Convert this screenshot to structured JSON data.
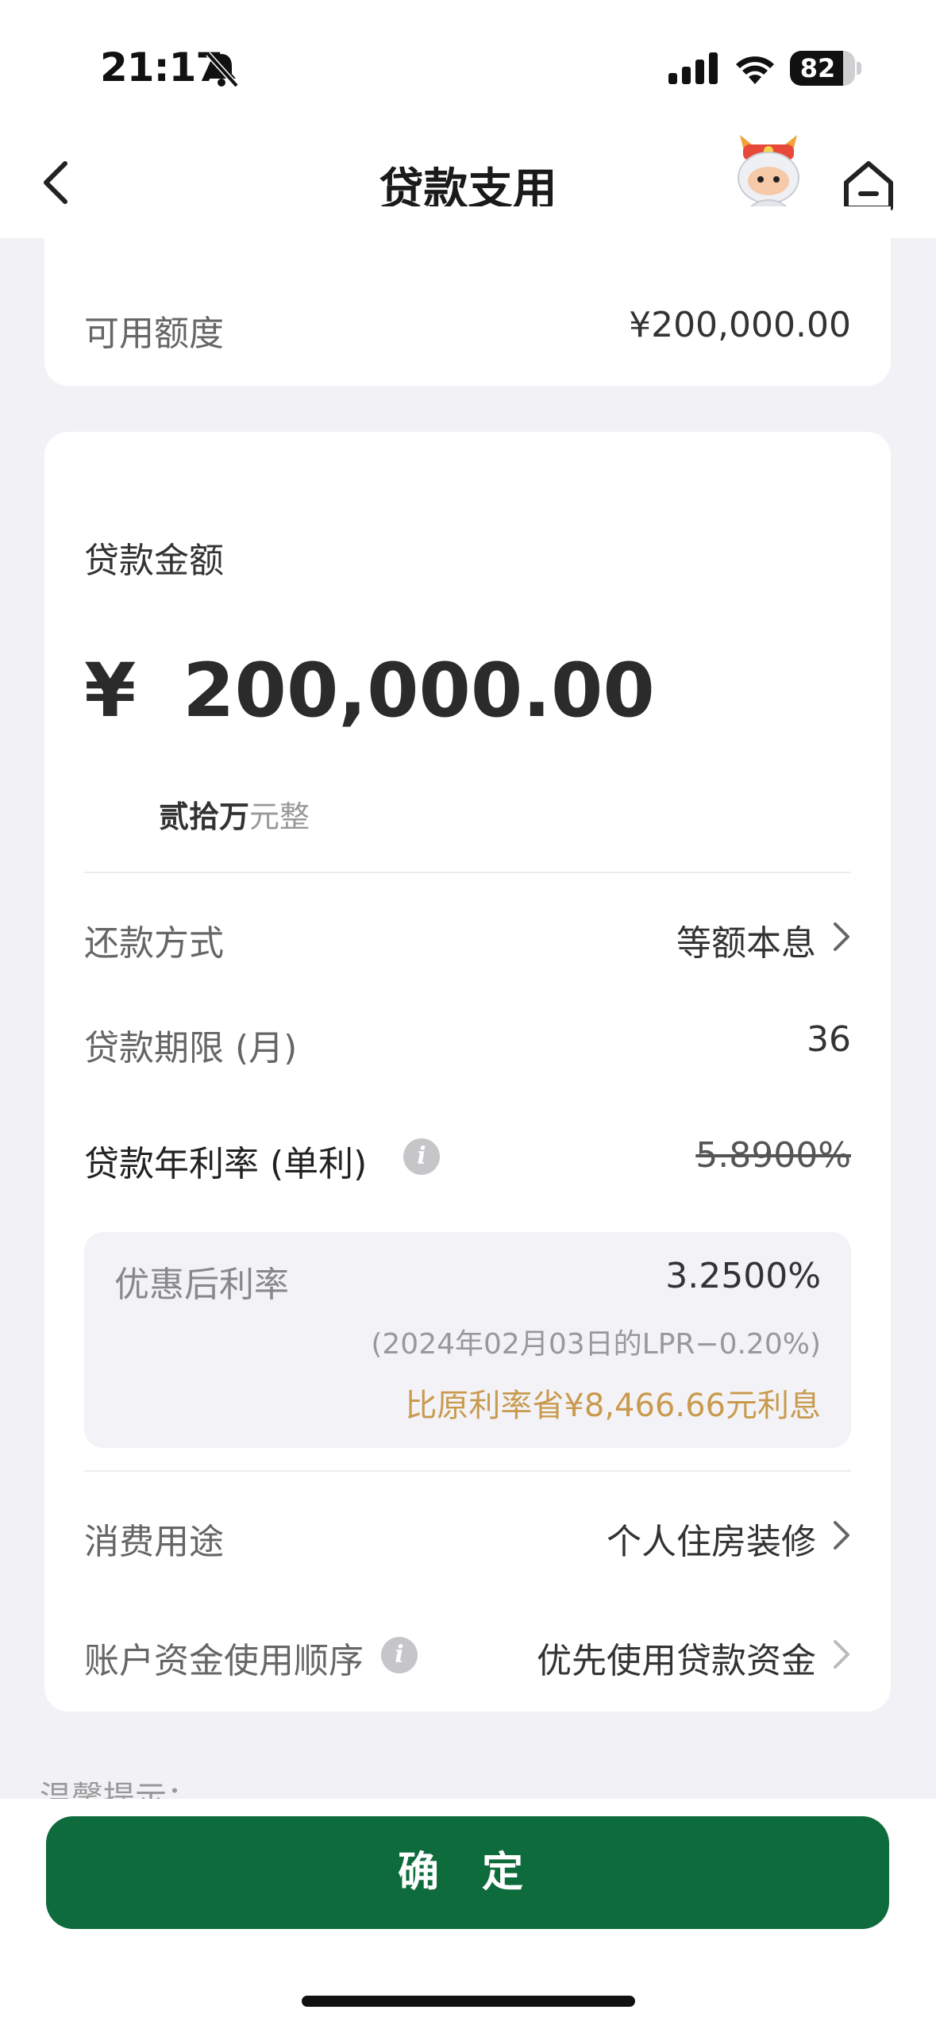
{
  "status_bar": {
    "time": "21:17",
    "battery_level": "82",
    "battery_fraction": 0.82
  },
  "nav": {
    "title": "贷款支用",
    "back_icon": "chevron-left-icon",
    "home_icon": "home-icon"
  },
  "available": {
    "label": "可用额度",
    "value": "¥200,000.00"
  },
  "loan": {
    "amount_label": "贷款金额",
    "currency_symbol": "¥",
    "amount": "200,000.00",
    "amount_chinese_bold": "贰拾万",
    "amount_chinese_suffix": "元整"
  },
  "repayment": {
    "label": "还款方式",
    "value": "等额本息"
  },
  "term": {
    "label": "贷款期限 (月)",
    "value": "36"
  },
  "annual_rate": {
    "label": "贷款年利率 (单利)",
    "original_value": "5.8900%"
  },
  "discount": {
    "label": "优惠后利率",
    "value": "3.2500%",
    "note": "(2024年02月03日的LPR−0.20%)",
    "savings": "比原利率省¥8,466.66元利息",
    "savings_color": "#c99a4e"
  },
  "purpose": {
    "label": "消费用途",
    "value": "个人住房装修"
  },
  "fund_order": {
    "label": "账户资金使用顺序",
    "value": "优先使用贷款资金"
  },
  "tip_peek": "温馨提示：",
  "confirm_button": "确 定",
  "colors": {
    "primary": "#0e6b3c",
    "background": "#f2f2f6"
  }
}
